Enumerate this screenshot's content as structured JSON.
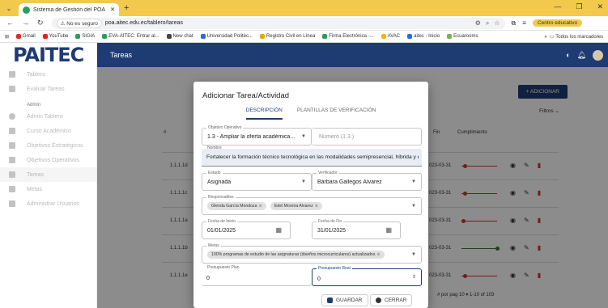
{
  "browser": {
    "tab_title": "Sistema de Gestión del POA",
    "security": "No es seguro",
    "url": "poa.aitec.edu.ec/tablero/tareas",
    "profile_label": "Centro educativo",
    "bookmarks": [
      "Gmail",
      "YouTube",
      "SIGIA",
      "EVA-AITEC: Entrar al...",
      "New chat",
      "Universidad Politéc...",
      "Registro Civil en Línea",
      "Firma Electrónica -...",
      "AVAC",
      "aitec - Inicio",
      "Ecuarooms"
    ],
    "all_bookmarks": "Todos los marcadores"
  },
  "app": {
    "logo": "PAITEC",
    "page_title": "Tareas",
    "sidebar": {
      "items": [
        "Tablero",
        "Evaluar Tareas"
      ],
      "section_caption": "Admin",
      "admin_items": [
        "Admin Tablero",
        "Curso Académico",
        "Objetivos Estratégicos",
        "Objetivos Operativos",
        "Tareas",
        "Metas",
        "Administrar Usuarios"
      ]
    },
    "add_button": "+ ADICIONAR",
    "filters": "Filtros",
    "table": {
      "headers": [
        "#",
        "Fin",
        "Cumplimiento"
      ],
      "rows": [
        {
          "id": "1.1.1.1d",
          "fin": "023-03-31",
          "progress": 0.1
        },
        {
          "id": "1.1.1.1c",
          "fin": "023-03-31",
          "progress": 0.1
        },
        {
          "id": "1.1.1.1a",
          "fin": "023-03-31",
          "progress": 0.05
        },
        {
          "id": "1.1.1.1b",
          "fin": "023-03-31",
          "progress": 1.0
        },
        {
          "id": "1.1.1.1e",
          "fin": "023-03-31",
          "progress": 0.1
        }
      ],
      "pager": "# por pag  10  ▾      1-10 of 103"
    }
  },
  "modal": {
    "title": "Adicionar Tarea/Actividad",
    "tabs": [
      "DESCRIPCIÓN",
      "PLANTILLAS DE VERIFICACIÓN"
    ],
    "objetivo": {
      "label": "Objetivo Operativo",
      "value": "1.3 - Ampliar la oferta académica..."
    },
    "numero": {
      "placeholder": "Número (1.3.)"
    },
    "nombre": {
      "label": "Nombre",
      "value": "Fortalecer la formación técnico tecnológica en las modalidades semipresencial, híbrida y en"
    },
    "estado": {
      "label": "Estado",
      "value": "Asignada"
    },
    "verificador": {
      "label": "Verificador",
      "value": "Bárbara Gallegos Álvarez"
    },
    "responsables": {
      "label": "Responsables",
      "chips": [
        "Glenda García Mendoza",
        "Edel Moreira Alvarez"
      ]
    },
    "fecha_inicio": {
      "label": "Fecha de Inicio",
      "value": "01/01/2025"
    },
    "fecha_fin": {
      "label": "Fecha de Fin",
      "value": "31/01/2025"
    },
    "metas": {
      "label": "Metas",
      "chip": "100% programas de estudio de las asignaturas (diseños microcurriculares) actualizados"
    },
    "presupuesto_plan": {
      "label": "Presupuesto Plan",
      "value": "0"
    },
    "presupuesto_real": {
      "label": "Presupuesto Real",
      "value": "0"
    },
    "save": "GUARDAR",
    "cancel": "CERRAR"
  }
}
